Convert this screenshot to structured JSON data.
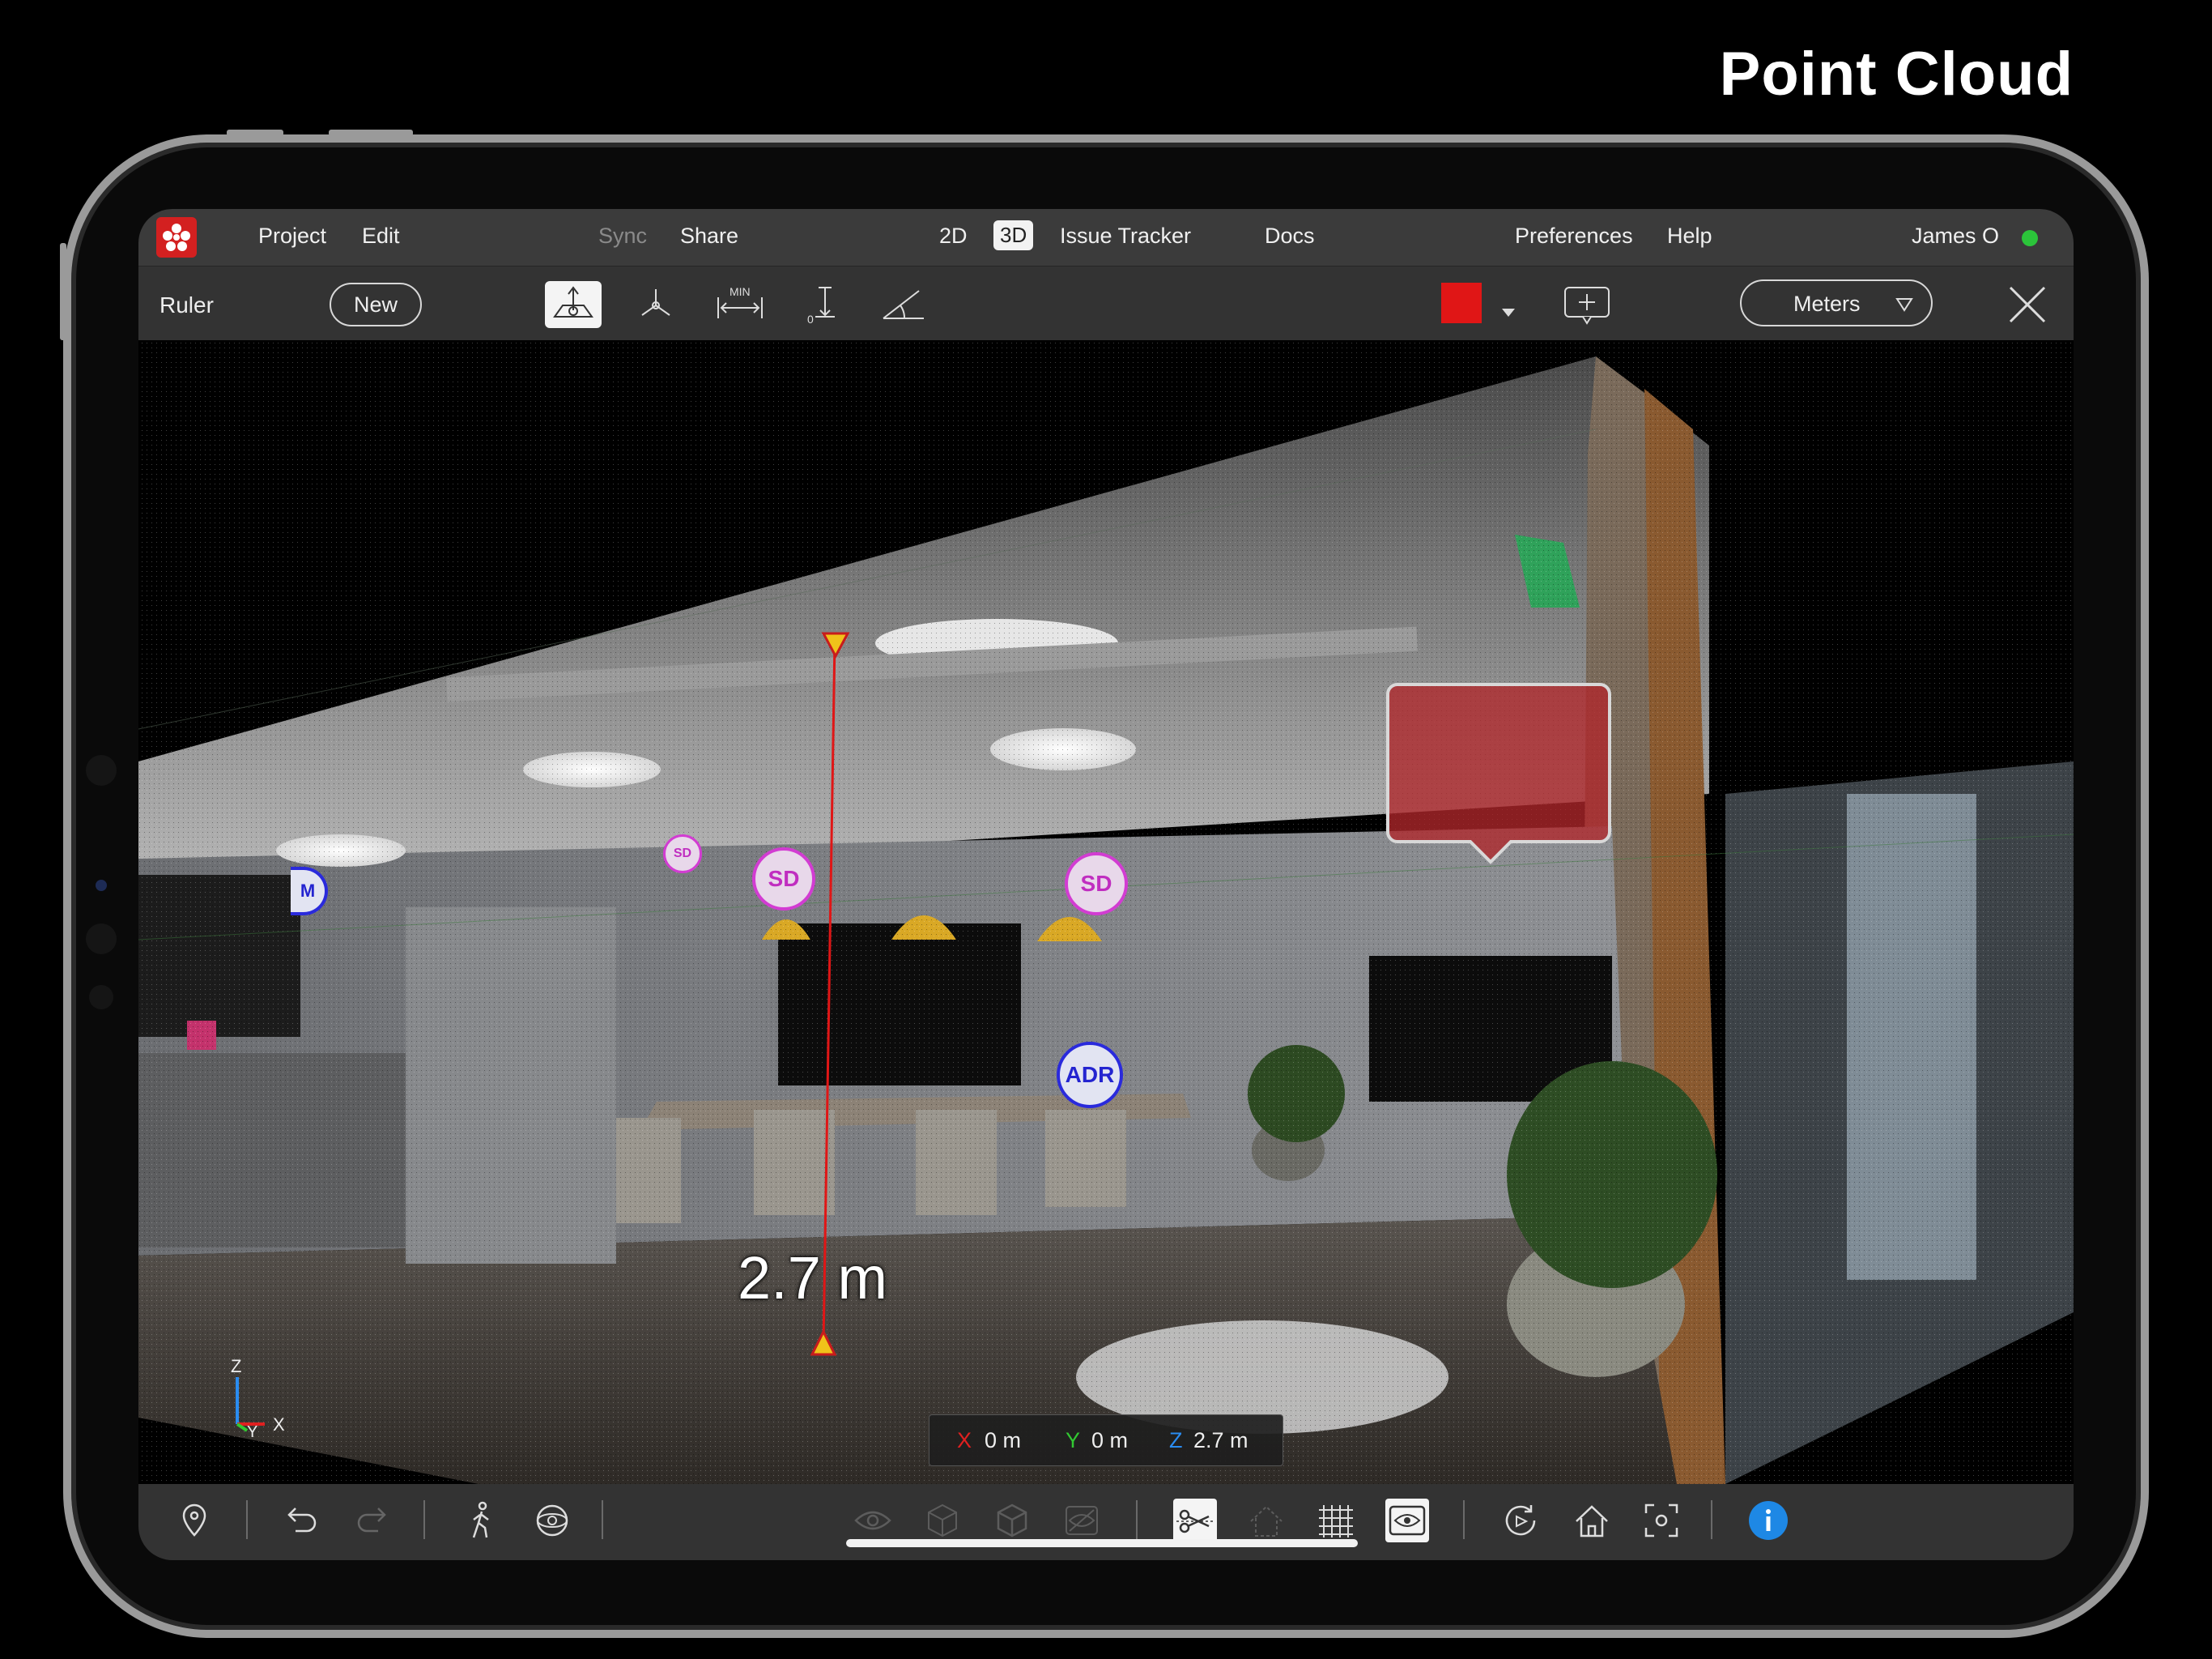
{
  "caption": "Point Cloud",
  "menu": {
    "project": "Project",
    "edit": "Edit",
    "sync": "Sync",
    "share": "Share",
    "view_2d": "2D",
    "view_3d": "3D",
    "issue_tracker": "Issue Tracker",
    "docs": "Docs",
    "preferences": "Preferences",
    "help": "Help",
    "user": "James O"
  },
  "toolbar": {
    "mode_label": "Ruler",
    "new_label": "New",
    "units": "Meters",
    "swatch_color": "#e01616"
  },
  "markers": {
    "sd": "SD",
    "adr": "ADR",
    "m": "M"
  },
  "measurement": {
    "label": "2.7 m"
  },
  "coords": {
    "x_label": "X",
    "x_value": "0 m",
    "y_label": "Y",
    "y_value": "0 m",
    "z_label": "Z",
    "z_value": "2.7 m"
  },
  "axis": {
    "z": "Z",
    "y": "Y",
    "x": "X"
  }
}
